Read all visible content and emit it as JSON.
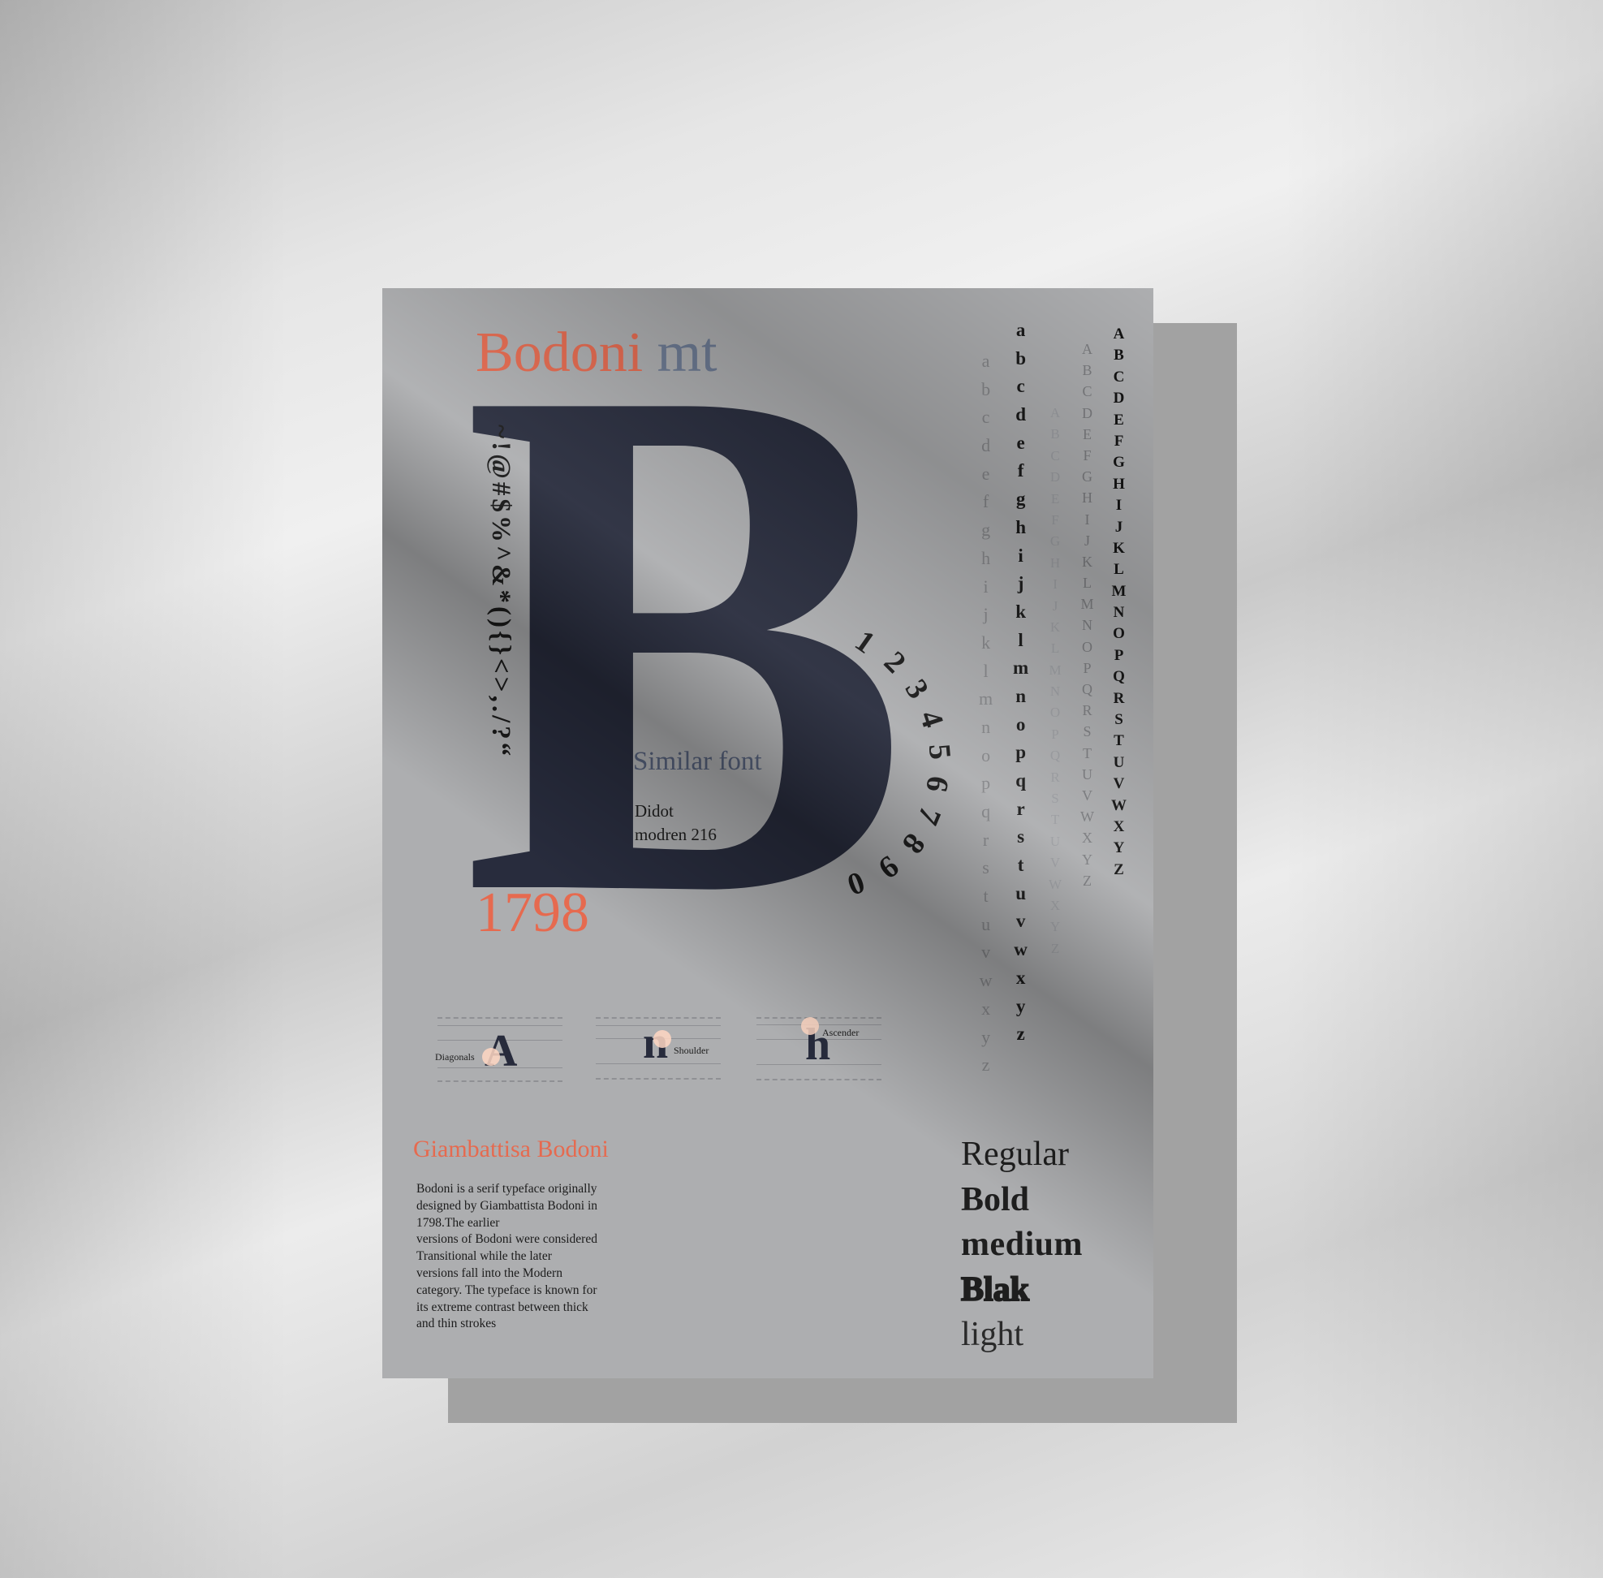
{
  "poster": {
    "title_part1": "Bodoni",
    "title_part2": "mt",
    "big_letter": "B",
    "symbols": "~!@#$%^&*(){}<>,./?“",
    "similar_heading": "Similar font",
    "similar_fonts": [
      "Didot",
      "modren 216"
    ],
    "digits": [
      "1",
      "2",
      "3",
      "4",
      "5",
      "6",
      "7",
      "8",
      "9",
      "0"
    ],
    "year": "1798",
    "lowercase": [
      "a",
      "b",
      "c",
      "d",
      "e",
      "f",
      "g",
      "h",
      "i",
      "j",
      "k",
      "l",
      "m",
      "n",
      "o",
      "p",
      "q",
      "r",
      "s",
      "t",
      "u",
      "v",
      "w",
      "x",
      "y",
      "z"
    ],
    "uppercase": [
      "A",
      "B",
      "C",
      "D",
      "E",
      "F",
      "G",
      "H",
      "I",
      "J",
      "K",
      "L",
      "M",
      "N",
      "O",
      "P",
      "Q",
      "R",
      "S",
      "T",
      "U",
      "V",
      "W",
      "X",
      "Y",
      "Z"
    ],
    "anatomy": [
      {
        "glyph": "A",
        "label": "Diagonals"
      },
      {
        "glyph": "n",
        "label": "Shoulder"
      },
      {
        "glyph": "h",
        "label": "Ascender"
      }
    ],
    "bio_title": "Giambattisa Bodoni",
    "bio_text": "Bodoni is a serif  typeface  originally\ndesigned by Giambattista Bodoni in\n1798.The earlier\n versions of  Bodoni were considered\nTransitional while the later\nversions fall into the Modern\ncategory. The typeface is known for\nits extreme contrast between thick\nand thin strokes",
    "weights": [
      "Regular",
      "Bold",
      "medium",
      "Blak",
      "light"
    ]
  },
  "colors": {
    "accent_coral": "#e66a4f",
    "accent_slate": "#6c7a93",
    "letter_navy": "#282c3d",
    "poster_gray": "#adaeb0"
  }
}
